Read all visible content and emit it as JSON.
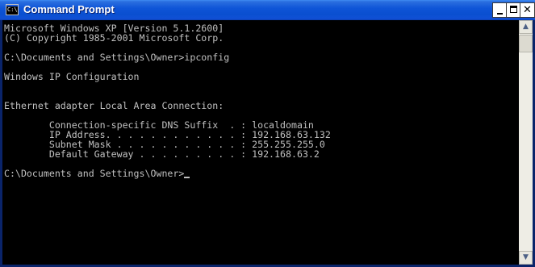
{
  "window": {
    "title": "Command Prompt",
    "icon": "cmd-icon",
    "controls": {
      "minimize": "minimize-icon",
      "maximize": "maximize-icon",
      "close": "close-icon"
    }
  },
  "console": {
    "lines": [
      "Microsoft Windows XP [Version 5.1.2600]",
      "(C) Copyright 1985-2001 Microsoft Corp.",
      "",
      "C:\\Documents and Settings\\Owner>ipconfig",
      "",
      "Windows IP Configuration",
      "",
      "",
      "Ethernet adapter Local Area Connection:",
      "",
      "        Connection-specific DNS Suffix  . : localdomain",
      "        IP Address. . . . . . . . . . . . : 192.168.63.132",
      "        Subnet Mask . . . . . . . . . . . : 255.255.255.0",
      "        Default Gateway . . . . . . . . . : 192.168.63.2",
      "",
      "C:\\Documents and Settings\\Owner>"
    ]
  },
  "colors": {
    "console_background": "#000000",
    "console_text": "#c0c0c0",
    "titlebar": "#0a4fd0"
  }
}
